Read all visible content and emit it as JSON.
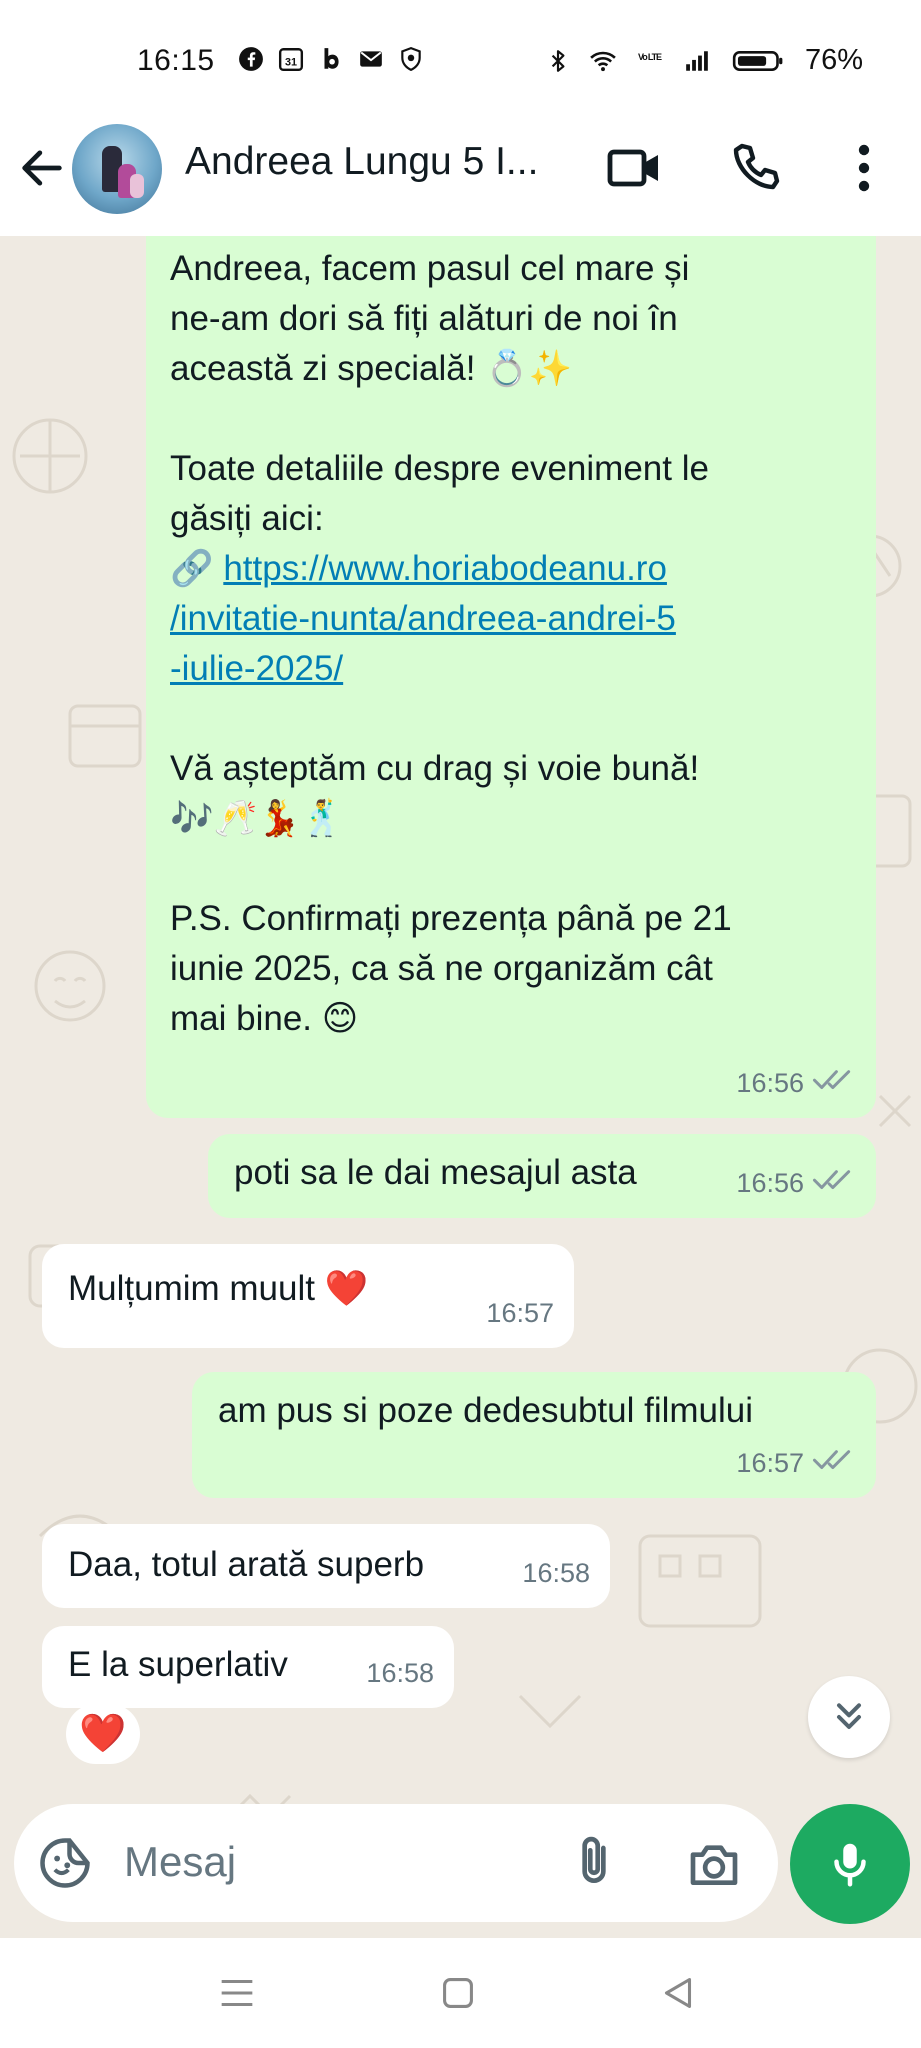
{
  "status_bar": {
    "time": "16:15",
    "battery_percent": "76%",
    "left_icons": [
      "facebook-icon",
      "calendar-icon",
      "b-app-icon",
      "mail-icon",
      "shield-icon"
    ],
    "right_icons": [
      "bluetooth-icon",
      "wifi-icon",
      "volte-icon",
      "signal-icon",
      "battery-icon"
    ],
    "calendar_day": "31",
    "volte_label": "Vo LTE"
  },
  "header": {
    "contact_name": "Andreea Lungu 5 I...",
    "icons": [
      "back-arrow-icon",
      "video-call-icon",
      "phone-icon",
      "more-vert-icon"
    ]
  },
  "messages": [
    {
      "direction": "outgoing",
      "segments": [
        {
          "type": "text",
          "value": "Andreea, facem pasul cel mare și\nne-am dori să fiți alături de noi în\naceastă zi specială! 💍✨\n\nToate detaliile despre eveniment le\ngăsiți aici:\n🔗 "
        },
        {
          "type": "link",
          "value": "https://www.horiabodeanu.ro\n/invitatie-nunta/andreea-andrei-5\n-iulie-2025/"
        },
        {
          "type": "text",
          "value": "\n\nVă așteptăm cu drag și voie bună!\n🎶🥂💃🕺\n\nP.S. Confirmați prezența până pe 21\niunie 2025, ca să ne organizăm cât\nmai bine. 😊"
        }
      ],
      "time": "16:56",
      "read": true
    },
    {
      "direction": "outgoing",
      "text": "poti sa le dai mesajul asta",
      "time": "16:56",
      "read": true
    },
    {
      "direction": "incoming",
      "text": "Mulțumim muult ❤️",
      "time": "16:57"
    },
    {
      "direction": "outgoing",
      "text": "am pus si poze dedesubtul filmului",
      "time": "16:57",
      "read": true
    },
    {
      "direction": "incoming",
      "text": "Daa, totul arată superb",
      "time": "16:58"
    },
    {
      "direction": "incoming",
      "text": "E la superlativ",
      "time": "16:58",
      "reaction": "❤️"
    }
  ],
  "input": {
    "placeholder": "Mesaj",
    "icons": [
      "sticker-icon",
      "attach-icon",
      "camera-icon",
      "mic-icon"
    ]
  },
  "scroll_button_icon": "double-chevron-down-icon",
  "nav": [
    "menu-icon",
    "home-square-icon",
    "back-triangle-icon"
  ],
  "colors": {
    "outgoing_bubble": "#d9fdd3",
    "incoming_bubble": "#ffffff",
    "chat_background": "#efeae2",
    "link": "#027eb5",
    "accent_green": "#1daa61",
    "timestamp": "#667781"
  }
}
